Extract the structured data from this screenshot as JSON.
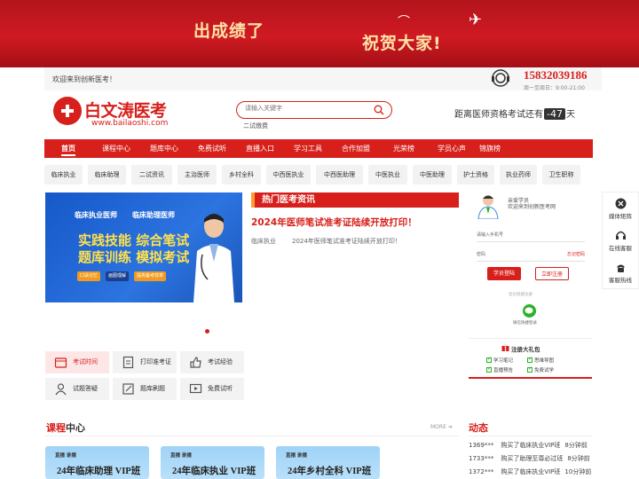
{
  "banner": {
    "text1": "出成绩了",
    "text2": "祝贺大家!"
  },
  "topbar": {
    "welcome": "欢迎来到创新医考！",
    "phone": "15832039186",
    "hours": "周一至周日：9:00-21:00"
  },
  "logo": {
    "name": "白文涛医考",
    "url": "www.bailaoshi.com"
  },
  "search": {
    "placeholder": "请输入关键字",
    "hot": "二试缴费"
  },
  "countdown": {
    "prefix": "距离医师资格考试还有",
    "days": "-47",
    "suffix": "天"
  },
  "nav": [
    "首页",
    "课程中心",
    "题库中心",
    "免费试听",
    "直播入口",
    "学习工具",
    "合作加盟",
    "光荣榜",
    "学员心声",
    "锦旗榜"
  ],
  "tags": [
    "临床执业",
    "临床助理",
    "二试资讯",
    "主治医师",
    "乡村全科",
    "中西医执业",
    "中西医助理",
    "中医执业",
    "中医助理",
    "护士资格",
    "执业药师",
    "卫生职称"
  ],
  "slide": {
    "line1a": "临床执业医师",
    "line1b": "临床助理医师",
    "line2": "实践技能 综合笔试",
    "line3": "题库训练 模拟考试",
    "chips": [
      "口诀记忆",
      "画图理解",
      "提高备考效率"
    ]
  },
  "news": {
    "title": "热门医考资讯",
    "headline": "2024年医师笔试准考证陆续开放打印！",
    "row_category": "临床执业",
    "row_text": "2024年医师笔试准考证陆续开放打印！"
  },
  "quick": [
    "考试时间",
    "打印准考证",
    "考试经验",
    "试题答疑",
    "题库刷题",
    "免费试听"
  ],
  "login": {
    "greet1": "亲爱学员",
    "greet2": "欢迎来到创新医考网",
    "phone_ph": "请输入手机号",
    "pwd_ph": "密码",
    "forget": "忘记密码",
    "login_btn": "学员登陆",
    "register_btn": "立即注册",
    "tip": "您也快捷注册",
    "wechat": "微信快捷登录"
  },
  "gift": {
    "title": "注册大礼包",
    "items": [
      "学习笔记",
      "思维导图",
      "直播预告",
      "免费试学"
    ]
  },
  "side": [
    "媒体矩阵",
    "在线客服",
    "客服热线"
  ],
  "course": {
    "title_hl": "课程",
    "title_rest": "中心",
    "more": "MORE"
  },
  "cards": [
    {
      "tag": "直播 录播",
      "name": "24年临床助理 VIP班"
    },
    {
      "tag": "直播 录播",
      "name": "24年临床执业 VIP班"
    },
    {
      "tag": "直播 录播",
      "name": "24年乡村全科 VIP班"
    }
  ],
  "dynamic": {
    "title": "动态",
    "rows": [
      {
        "user": "1369***",
        "action": "购买了临床执业VIP班",
        "time": "8分钟前"
      },
      {
        "user": "1733***",
        "action": "购买了助理至尊必过班",
        "time": "8分钟前"
      },
      {
        "user": "1372***",
        "action": "购买了临床执业VIP班",
        "time": "10分钟前"
      }
    ]
  },
  "colors": {
    "brand": "#d7201b",
    "accent": "#ff9c31"
  }
}
